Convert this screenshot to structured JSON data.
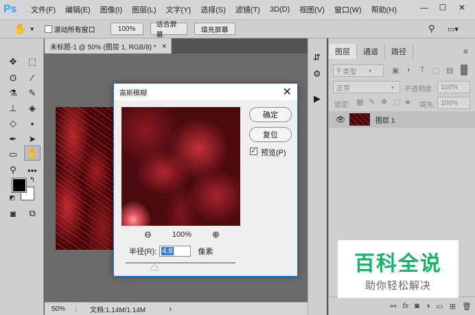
{
  "app": {
    "logo": "Ps"
  },
  "menu": [
    "文件(F)",
    "编辑(E)",
    "图像(I)",
    "图层(L)",
    "文字(Y)",
    "选择(S)",
    "滤镜(T)",
    "3D(D)",
    "视图(V)",
    "窗口(W)",
    "帮助(H)"
  ],
  "window_controls": {
    "minimize": "—",
    "restore": "☐",
    "close": "✕"
  },
  "options_bar": {
    "scroll_all_label": "滚动所有窗口",
    "zoom_100": "100%",
    "fit_screen": "适合屏幕",
    "fill_screen": "填充屏幕"
  },
  "document": {
    "tab_title": "未标题-1 @ 50% (图层 1, RGB/8) *",
    "tab_close": "×",
    "zoom": "50%",
    "doc_info": "文档:1.14M/1.14M",
    "status_arrow": "›"
  },
  "layers_panel": {
    "tabs": [
      "图层",
      "通道",
      "路径"
    ],
    "filter_kind": "类型",
    "blend_mode": "正常",
    "opacity_label": "不透明度:",
    "opacity_value": "100%",
    "lock_label": "锁定:",
    "fill_label": "填充:",
    "fill_value": "100%",
    "layer_name": "图层 1"
  },
  "dialog": {
    "title": "高斯模糊",
    "ok": "确定",
    "reset": "复位",
    "preview_label": "预览(P)",
    "preview_checked": true,
    "zoom_level": "100%",
    "radius_label": "半径(R):",
    "radius_value": "4.8",
    "radius_unit": "像素"
  },
  "watermark": {
    "main": "百科全说",
    "sub": "助你轻松解决"
  }
}
